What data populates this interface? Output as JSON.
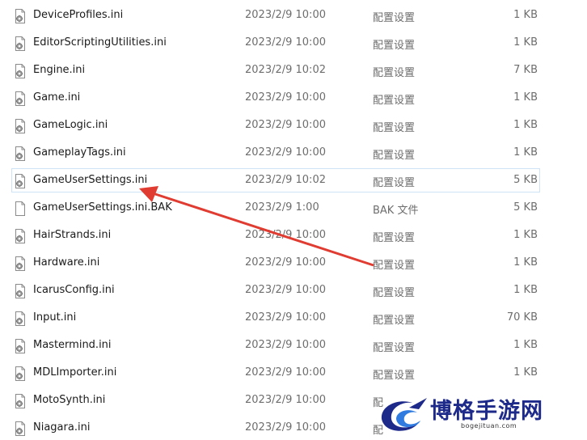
{
  "files": [
    {
      "name": "DeviceProfiles.ini",
      "date": "2023/2/9 10:00",
      "type": "配置设置",
      "size": "1 KB",
      "icon": "config-file-icon"
    },
    {
      "name": "EditorScriptingUtilities.ini",
      "date": "2023/2/9 10:00",
      "type": "配置设置",
      "size": "1 KB",
      "icon": "config-file-icon"
    },
    {
      "name": "Engine.ini",
      "date": "2023/2/9 10:02",
      "type": "配置设置",
      "size": "7 KB",
      "icon": "config-file-icon"
    },
    {
      "name": "Game.ini",
      "date": "2023/2/9 10:00",
      "type": "配置设置",
      "size": "1 KB",
      "icon": "config-file-icon"
    },
    {
      "name": "GameLogic.ini",
      "date": "2023/2/9 10:00",
      "type": "配置设置",
      "size": "1 KB",
      "icon": "config-file-icon"
    },
    {
      "name": "GameplayTags.ini",
      "date": "2023/2/9 10:00",
      "type": "配置设置",
      "size": "1 KB",
      "icon": "config-file-icon"
    },
    {
      "name": "GameUserSettings.ini",
      "date": "2023/2/9 10:02",
      "type": "配置设置",
      "size": "5 KB",
      "icon": "config-file-icon",
      "selected": true
    },
    {
      "name": "GameUserSettings.ini.BAK",
      "date": "2023/2/9 1:00",
      "type": "BAK 文件",
      "size": "5 KB",
      "icon": "blank-file-icon"
    },
    {
      "name": "HairStrands.ini",
      "date": "2023/2/9 10:00",
      "type": "配置设置",
      "size": "1 KB",
      "icon": "config-file-icon"
    },
    {
      "name": "Hardware.ini",
      "date": "2023/2/9 10:00",
      "type": "配置设置",
      "size": "1 KB",
      "icon": "config-file-icon"
    },
    {
      "name": "IcarusConfig.ini",
      "date": "2023/2/9 10:00",
      "type": "配置设置",
      "size": "1 KB",
      "icon": "config-file-icon"
    },
    {
      "name": "Input.ini",
      "date": "2023/2/9 10:00",
      "type": "配置设置",
      "size": "70 KB",
      "icon": "config-file-icon"
    },
    {
      "name": "Mastermind.ini",
      "date": "2023/2/9 10:00",
      "type": "配置设置",
      "size": "1 KB",
      "icon": "config-file-icon"
    },
    {
      "name": "MDLImporter.ini",
      "date": "2023/2/9 10:00",
      "type": "配置设置",
      "size": "1 KB",
      "icon": "config-file-icon"
    },
    {
      "name": "MotoSynth.ini",
      "date": "2023/2/9 10:00",
      "type": "配",
      "size": "",
      "icon": "config-file-icon"
    },
    {
      "name": "Niagara.ini",
      "date": "2023/2/9 10:00",
      "type": "配",
      "size": "",
      "icon": "config-file-icon"
    }
  ],
  "annotation": {
    "arrow_color": "#e03c31"
  },
  "watermark": {
    "brand": "博格手游网",
    "url": "bogejituan.com",
    "logo_colors": [
      "#1e2a8a",
      "#2f7be0"
    ]
  }
}
